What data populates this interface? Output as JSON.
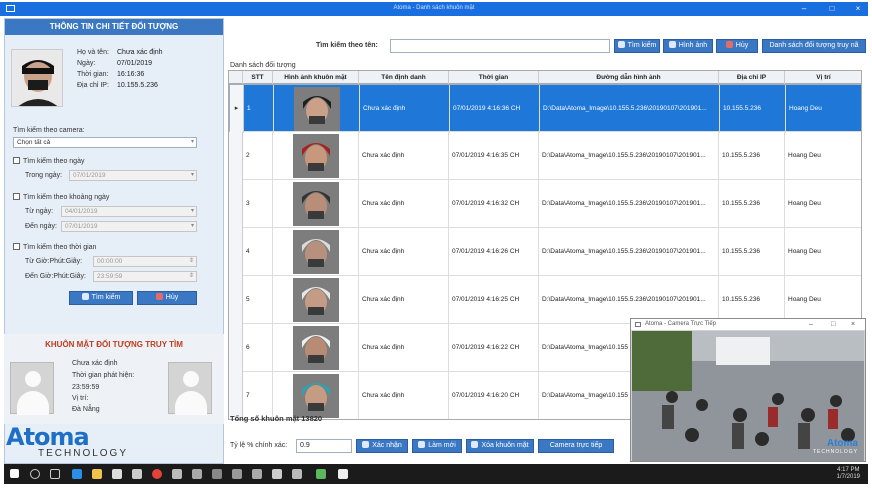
{
  "window": {
    "title": "Atoma - Danh sách khuôn mặt"
  },
  "detail": {
    "header": "THÔNG TIN CHI TIẾT ĐỐI TƯỢNG",
    "name_label": "Họ và tên:",
    "name_value": "Chưa xác định",
    "date_label": "Ngày:",
    "date_value": "07/01/2019",
    "time_label": "Thời gian:",
    "time_value": "16:16:36",
    "ip_label": "Địa chỉ IP:",
    "ip_value": "10.155.5.236"
  },
  "filters": {
    "camera_label": "Tìm kiếm theo camera:",
    "camera_value": "Chọn tất cả",
    "by_day_label": "Tìm kiếm theo ngày",
    "in_day_label": "Trong ngày:",
    "in_day_value": "07/01/2019",
    "by_range_label": "Tìm kiếm theo khoảng ngày",
    "from_day_label": "Từ ngày:",
    "from_day_value": "04/01/2019",
    "to_day_label": "Đến ngày:",
    "to_day_value": "07/01/2019",
    "by_time_label": "Tìm kiếm theo thời gian",
    "from_time_label": "Từ Giờ:Phút:Giây:",
    "from_time_value": "00:00:00",
    "to_time_label": "Đến Giờ:Phút:Giây:",
    "to_time_value": "23:59:59",
    "search_btn": "Tìm kiếm",
    "cancel_btn": "Hủy"
  },
  "wanted": {
    "header": "KHUÔN MẶT ĐỐI TƯỢNG TRUY TÌM",
    "name": "Chưa xác định",
    "found_label": "Thời gian phát hiện:",
    "found_value": "23:59:59",
    "loc_label": "Vị trí:",
    "loc_value": "Đà Nẵng"
  },
  "logo": {
    "big": "Atoma",
    "small": "TECHNOLOGY"
  },
  "search": {
    "label": "Tìm kiếm theo tên:",
    "value": "",
    "search_btn": "Tìm kiếm",
    "image_btn": "Hình ảnh",
    "cancel_btn": "Hủy",
    "wanted_list_btn": "Danh sách đối tượng truy nã"
  },
  "table": {
    "title": "Danh sách đối tượng",
    "headers": [
      "STT",
      "Hình ảnh khuôn mặt",
      "Tên định danh",
      "Thời gian",
      "Đường dẫn hình ảnh",
      "Địa chỉ IP",
      "Vị trí"
    ],
    "rows": [
      {
        "stt": "1",
        "name": "Chưa xác định",
        "time": "07/01/2019 4:16:36 CH",
        "path": "D:\\Data\\Atoma_Image\\10.155.5.236\\20190107\\201901...",
        "ip": "10.155.5.236",
        "loc": "Hoang Deu"
      },
      {
        "stt": "2",
        "name": "Chưa xác định",
        "time": "07/01/2019 4:16:35 CH",
        "path": "D:\\Data\\Atoma_Image\\10.155.5.236\\20190107\\201901...",
        "ip": "10.155.5.236",
        "loc": "Hoang Deu"
      },
      {
        "stt": "3",
        "name": "Chưa xác định",
        "time": "07/01/2019 4:16:32 CH",
        "path": "D:\\Data\\Atoma_Image\\10.155.5.236\\20190107\\201901...",
        "ip": "10.155.5.236",
        "loc": "Hoang Deu"
      },
      {
        "stt": "4",
        "name": "Chưa xác định",
        "time": "07/01/2019 4:16:26 CH",
        "path": "D:\\Data\\Atoma_Image\\10.155.5.236\\20190107\\201901...",
        "ip": "10.155.5.236",
        "loc": "Hoang Deu"
      },
      {
        "stt": "5",
        "name": "Chưa xác định",
        "time": "07/01/2019 4:16:25 CH",
        "path": "D:\\Data\\Atoma_Image\\10.155.5.236\\20190107\\201901...",
        "ip": "10.155.5.236",
        "loc": "Hoang Deu"
      },
      {
        "stt": "6",
        "name": "Chưa xác định",
        "time": "07/01/2019 4:16:22 CH",
        "path": "D:\\Data\\Atoma_Image\\10.155",
        "ip": "",
        "loc": ""
      },
      {
        "stt": "7",
        "name": "Chưa xác định",
        "time": "07/01/2019 4:16:20 CH",
        "path": "D:\\Data\\Atoma_Image\\10.155",
        "ip": "",
        "loc": ""
      }
    ],
    "total_label": "Tổng số khuôn mặt 13820"
  },
  "bottom": {
    "ratio_label": "Tỷ lệ % chính xác:",
    "ratio_value": "0.9",
    "confirm_btn": "Xác nhận",
    "refresh_btn": "Làm mới",
    "delete_btn": "Xóa khuôn mặt",
    "live_btn": "Camera trực tiếp"
  },
  "camera_window": {
    "title": "Atoma - Camera Trực Tiếp",
    "brand": "Atoma",
    "brand_sub": "TECHNOLOGY"
  },
  "taskbar": {
    "time": "4:17 PM",
    "date": "1/7/2019"
  },
  "colors": {
    "accent": "#3a78c4",
    "selected_row": "#1f78d8",
    "header_text": "#ffffff",
    "wanted_title": "#c13b1f"
  }
}
